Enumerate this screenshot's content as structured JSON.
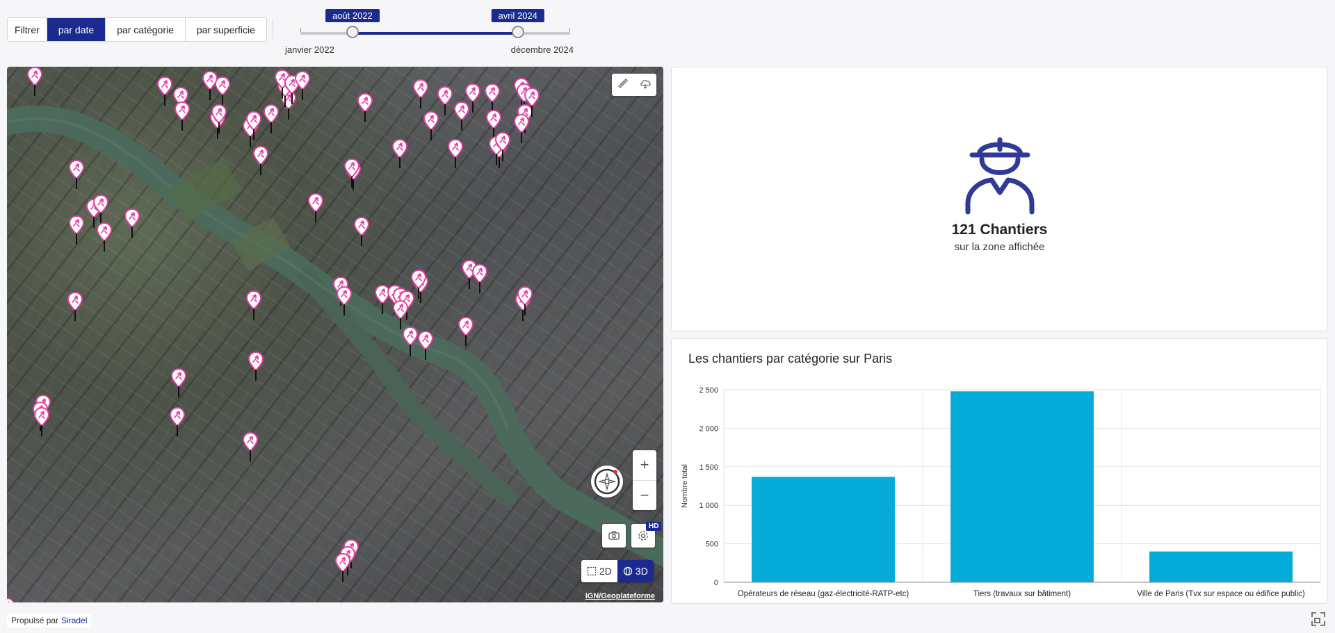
{
  "filters": {
    "label": "Filtrer",
    "options": [
      "par date",
      "par catégorie",
      "par superficie"
    ],
    "active": "par date"
  },
  "date_slider": {
    "start_label": "janvier 2022",
    "end_label": "décembre 2024",
    "range_start": "août 2022",
    "range_end": "avril 2024",
    "start_fraction": 0.193,
    "end_fraction": 0.806
  },
  "map": {
    "attribution": "IGN/Geoplateforme",
    "view_2d": "2D",
    "view_3d": "3D",
    "active_view": "3D",
    "hd_badge": "HD",
    "pin_icon": "worker-drill-icon",
    "accent": "#e040a0"
  },
  "kpi": {
    "icon": "construction-worker-icon",
    "value": "121 Chantiers",
    "subtitle": "sur la zone affichée",
    "color": "#2f3a96"
  },
  "chart_data": {
    "type": "bar",
    "title": "Les chantiers par catégorie sur Paris",
    "ylabel": "Nombre total",
    "xlabel": "",
    "categories": [
      "Opérateurs de réseau (gaz-électricité-RATP-etc)",
      "Tiers (travaux sur bâtiment)",
      "Ville de Paris (Tvx sur espace ou édifice public)"
    ],
    "values": [
      1370,
      2480,
      400
    ],
    "ylim": [
      0,
      2500
    ],
    "yticks": [
      0,
      500,
      1000,
      1500,
      2000,
      2500
    ],
    "ytick_labels": [
      "0",
      "500",
      "1 000",
      "1 500",
      "2 000",
      "2 500"
    ],
    "bar_color": "#06acd9",
    "grid": true
  },
  "footer": {
    "powered_by": "Propulsé par",
    "brand": "Siradel"
  }
}
